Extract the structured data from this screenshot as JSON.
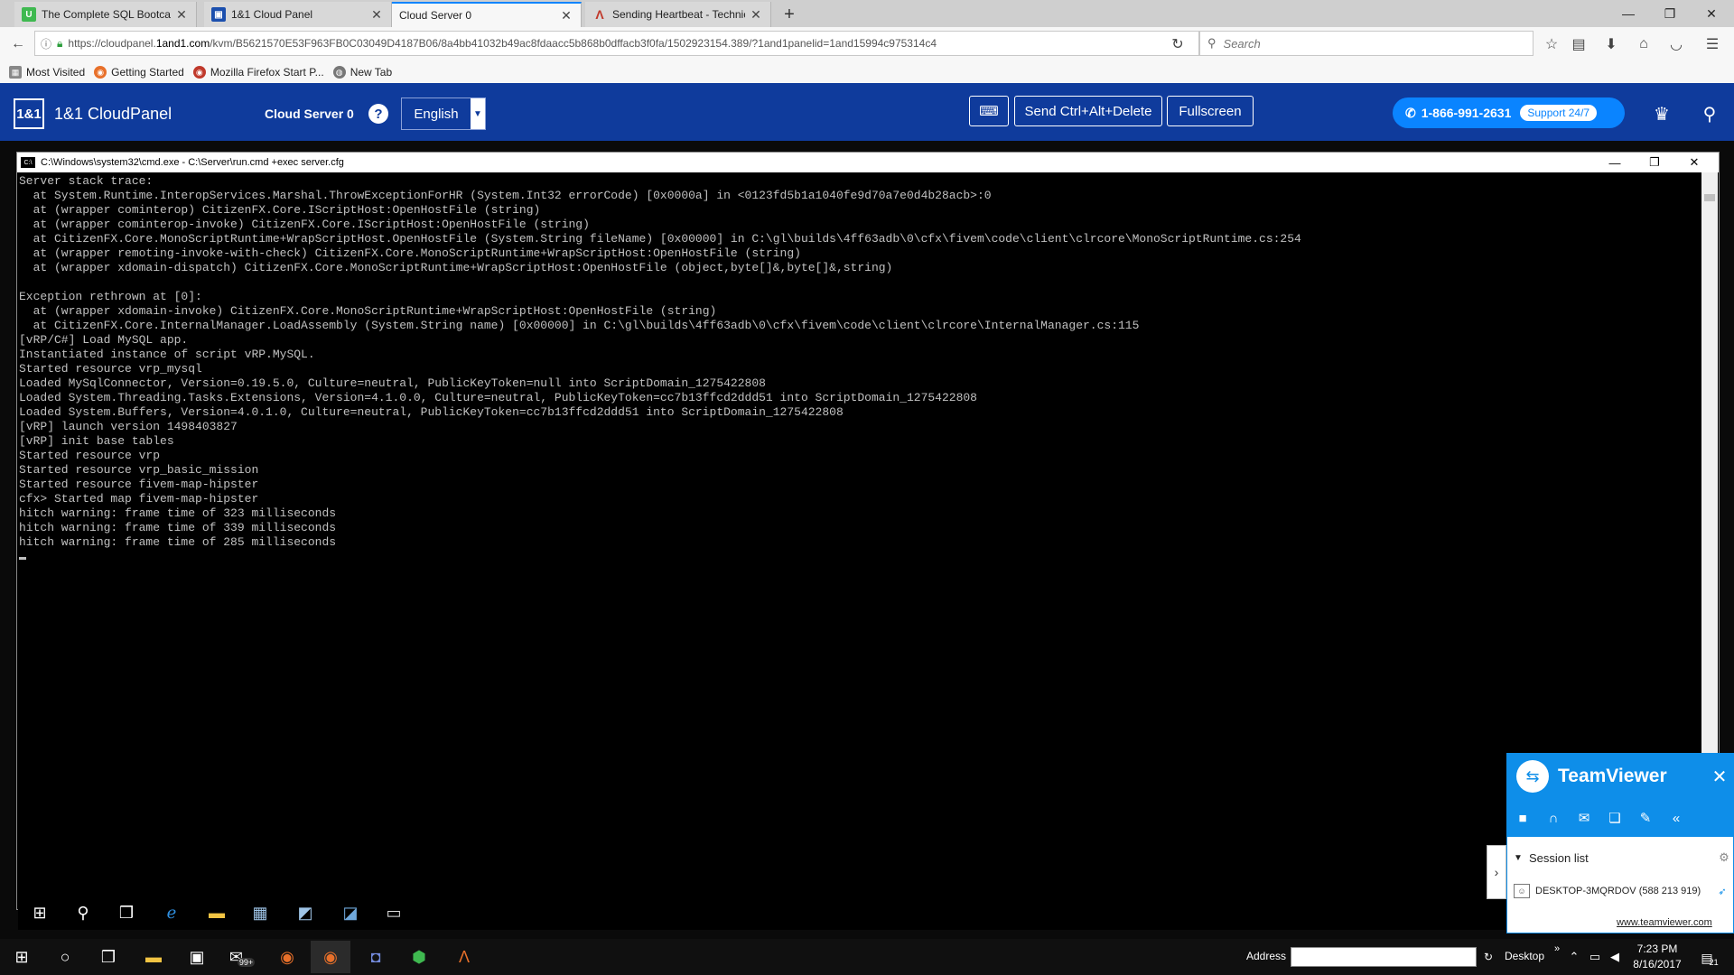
{
  "browser": {
    "tabs": [
      {
        "title": "The Complete SQL Bootcamp",
        "favicon": "U",
        "active": false
      },
      {
        "title": "1&1 Cloud Panel",
        "favicon": "▣",
        "active": false
      },
      {
        "title": "Cloud Server 0",
        "favicon": "",
        "active": true
      },
      {
        "title": "Sending Heartbeat - Technic",
        "favicon": "Λ",
        "active": false
      }
    ],
    "url_prefix": "https://cloudpanel.",
    "url_domain": "1and1.com",
    "url_rest": "/kvm/B5621570E53F963FB0C03049D4187B06/8a4bb41032b49ac8fdaacc5b868b0dffacb3f0fa/1502923154.389/?1and1panelid=1and15994c975314c4",
    "search_placeholder": "Search",
    "bookmarks": [
      "Most Visited",
      "Getting Started",
      "Mozilla Firefox Start P...",
      "New Tab"
    ]
  },
  "cloudpanel": {
    "logo": "1&1",
    "title": "1&1 CloudPanel",
    "server_name": "Cloud Server 0",
    "help": "?",
    "language": "English",
    "send_cad": "Send Ctrl+Alt+Delete",
    "fullscreen": "Fullscreen",
    "phone": "1-866-991-2631",
    "support": "Support 24/7"
  },
  "cmd": {
    "title": "C:\\Windows\\system32\\cmd.exe - C:\\Server\\run.cmd  +exec server.cfg",
    "lines": [
      "Server stack trace:",
      "  at System.Runtime.InteropServices.Marshal.ThrowExceptionForHR (System.Int32 errorCode) [0x0000a] in <0123fd5b1a1040fe9d70a7e0d4b28acb>:0",
      "  at (wrapper cominterop) CitizenFX.Core.IScriptHost:OpenHostFile (string)",
      "  at (wrapper cominterop-invoke) CitizenFX.Core.IScriptHost:OpenHostFile (string)",
      "  at CitizenFX.Core.MonoScriptRuntime+WrapScriptHost.OpenHostFile (System.String fileName) [0x00000] in C:\\gl\\builds\\4ff63adb\\0\\cfx\\fivem\\code\\client\\clrcore\\MonoScriptRuntime.cs:254",
      "  at (wrapper remoting-invoke-with-check) CitizenFX.Core.MonoScriptRuntime+WrapScriptHost:OpenHostFile (string)",
      "  at (wrapper xdomain-dispatch) CitizenFX.Core.MonoScriptRuntime+WrapScriptHost:OpenHostFile (object,byte[]&,byte[]&,string)",
      "",
      "Exception rethrown at [0]:",
      "  at (wrapper xdomain-invoke) CitizenFX.Core.MonoScriptRuntime+WrapScriptHost:OpenHostFile (string)",
      "  at CitizenFX.Core.InternalManager.LoadAssembly (System.String name) [0x00000] in C:\\gl\\builds\\4ff63adb\\0\\cfx\\fivem\\code\\client\\clrcore\\InternalManager.cs:115",
      "[vRP/C#] Load MySQL app.",
      "Instantiated instance of script vRP.MySQL.",
      "Started resource vrp_mysql",
      "Loaded MySqlConnector, Version=0.19.5.0, Culture=neutral, PublicKeyToken=null into ScriptDomain_1275422808",
      "Loaded System.Threading.Tasks.Extensions, Version=4.1.0.0, Culture=neutral, PublicKeyToken=cc7b13ffcd2ddd51 into ScriptDomain_1275422808",
      "Loaded System.Buffers, Version=4.0.1.0, Culture=neutral, PublicKeyToken=cc7b13ffcd2ddd51 into ScriptDomain_1275422808",
      "[vRP] launch version 1498403827",
      "[vRP] init base tables",
      "Started resource vrp",
      "Started resource vrp_basic_mission",
      "Started resource fivem-map-hipster",
      "cfx> Started map fivem-map-hipster",
      "hitch warning: frame time of 323 milliseconds",
      "hitch warning: frame time of 339 milliseconds",
      "hitch warning: frame time of 285 milliseconds"
    ]
  },
  "teamviewer": {
    "name": "TeamViewer",
    "session_list": "Session list",
    "device": "DESKTOP-3MQRDOV (588 213 919)",
    "link": "www.teamviewer.com"
  },
  "taskbar": {
    "address_label": "Address",
    "desktop_label": "Desktop",
    "time": "7:23 PM",
    "date": "8/16/2017",
    "notif_count": "21",
    "mail_badge": "99+"
  }
}
